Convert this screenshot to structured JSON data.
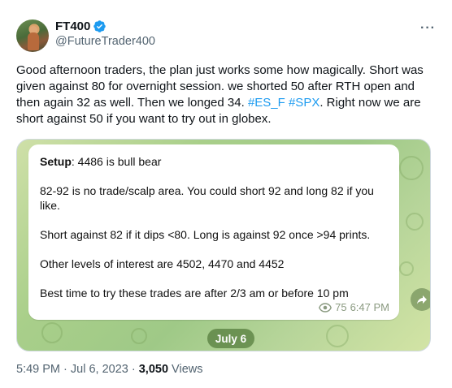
{
  "author": {
    "display_name": "FT400",
    "handle": "@FutureTrader400",
    "verified": true
  },
  "more_label": "···",
  "tweet": {
    "text_parts": [
      "Good afternoon traders, the plan just works some how magically. Short was given against 80 for overnight session. we shorted 50 after RTH open and then again 32 as well.  Then we longed 34. ",
      "#ES_F",
      " ",
      "#SPX",
      ". Right now we are short against 50 if you want to try out in globex."
    ]
  },
  "media": {
    "message": {
      "setup_label": "Setup",
      "setup_text": ": 4486 is bull bear",
      "line2": "82-92 is no trade/scalp area. You could short 92 and long 82 if you like.",
      "line3": "Short against 82 if it dips <80. Long is against 92 once >94 prints.",
      "line4": "Other levels of interest are 4502, 4470 and 4452",
      "line5": "Best time to try these trades are after 2/3 am or before 10 pm"
    },
    "views": "75",
    "time": "6:47 PM",
    "date_pill": "July 6",
    "share_icon": "forward-arrow-icon"
  },
  "footer": {
    "time": "5:49 PM",
    "sep1": " · ",
    "date": "Jul 6, 2023",
    "sep2": " · ",
    "views": "3,050",
    "views_label": " Views"
  },
  "colors": {
    "link": "#1d9bf0",
    "verified": "#1d9bf0",
    "secondary_text": "#536471",
    "media_bg": "#a9cf8a"
  }
}
